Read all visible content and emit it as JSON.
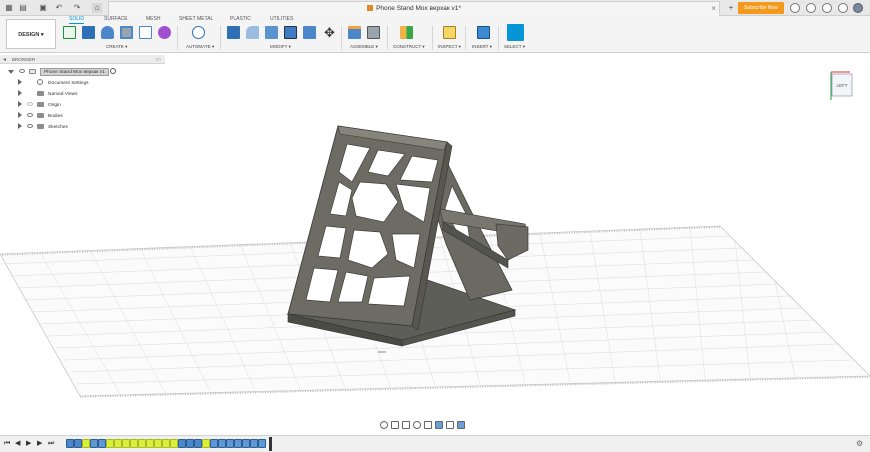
{
  "window": {
    "document_title": "Phone Stand Mox верхак v1*",
    "subscribe_label": "Subscribe Now"
  },
  "ribbon": {
    "workspace": "DESIGN",
    "tabs": [
      "SOLID",
      "SURFACE",
      "MESH",
      "SHEET METAL",
      "PLASTIC",
      "UTILITIES"
    ],
    "active_tab": "SOLID",
    "groups": [
      "CREATE",
      "AUTOMATE",
      "MODIFY",
      "ASSEMBLE",
      "CONSTRUCT",
      "INSPECT",
      "INSERT",
      "SELECT"
    ]
  },
  "browser": {
    "header": "BROWSER",
    "root": "Phone Stand Mox верхак v1",
    "items": [
      "Document Settings",
      "Named Views",
      "Origin",
      "Bodies",
      "Sketches"
    ]
  },
  "viewcube": {
    "face": "LEFT"
  },
  "colors": {
    "accent": "#0696d7",
    "subscribe": "#f39a1e",
    "model": "#6e6e66",
    "timeline_feature": "#d9ef3f",
    "timeline_sketch": "#4c88c9"
  },
  "icons": {
    "nav": [
      "orbit-icon",
      "pan-icon",
      "look-at-icon",
      "zoom-icon",
      "fit-icon",
      "display-settings-icon",
      "grid-settings-icon",
      "viewports-icon"
    ],
    "timeline_controls": [
      "skip-start-icon",
      "step-back-icon",
      "play-icon",
      "step-forward-icon",
      "skip-end-icon"
    ]
  }
}
